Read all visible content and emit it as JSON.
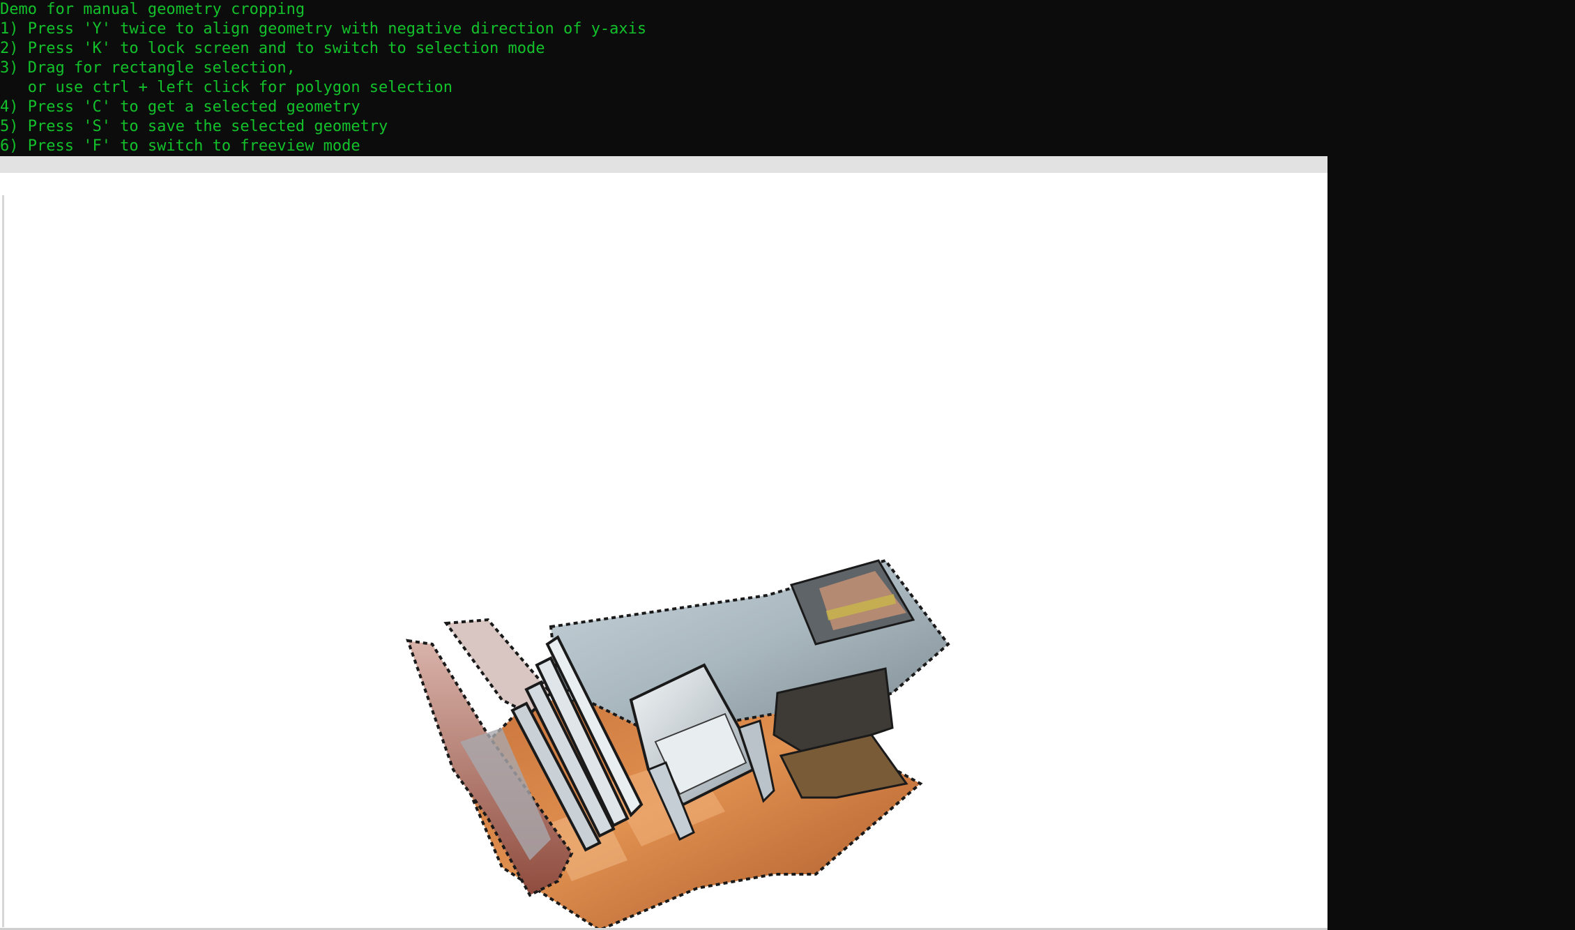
{
  "console": {
    "lines": [
      "Demo for manual geometry cropping",
      "1) Press 'Y' twice to align geometry with negative direction of y-axis",
      "2) Press 'K' to lock screen and to switch to selection mode",
      "3) Drag for rectangle selection,",
      "   or use ctrl + left click for polygon selection",
      "4) Press 'C' to get a selected geometry",
      "5) Press 'S' to save the selected geometry",
      "6) Press 'F' to switch to freeview mode"
    ],
    "text_color": "#13c22b",
    "background": "#0c0c0c"
  },
  "viewer": {
    "background": "#ffffff",
    "scene_icon": "point-cloud-room-scene"
  }
}
